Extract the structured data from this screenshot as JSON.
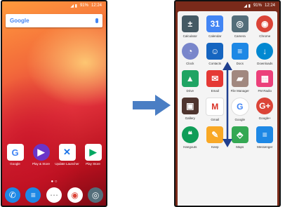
{
  "left_screen": {
    "status": {
      "battery": "91%",
      "time": "12:24"
    },
    "search": {
      "brand": "Google"
    },
    "apps": [
      {
        "label": "Google",
        "glyph": "G",
        "color": "#ffffff",
        "fg": "#4285f4",
        "icon": "google-icon"
      },
      {
        "label": "Play & Store",
        "glyph": "▶",
        "color": "#6a35c8",
        "fg": "#ffffff",
        "icon": "play-music-icon"
      },
      {
        "label": "Update Launcher",
        "glyph": "✕",
        "color": "#ffffff",
        "fg": "#1a73e8",
        "icon": "launcher-icon"
      },
      {
        "label": "Play Store",
        "glyph": "▶",
        "color": "#ffffff",
        "fg": "#00a862",
        "icon": "play-store-icon"
      }
    ],
    "dock": [
      {
        "glyph": "✆",
        "color": "#1e88e5",
        "icon": "phone-icon"
      },
      {
        "glyph": "≡",
        "color": "#1e88e5",
        "icon": "messages-icon"
      },
      {
        "glyph": "⋯",
        "color": "#ffffff",
        "fg": "#888888",
        "icon": "app-drawer-icon"
      },
      {
        "glyph": "◉",
        "color": "#ffffff",
        "fg": "#db4437",
        "icon": "chrome-icon"
      },
      {
        "glyph": "◎",
        "color": "#546e7a",
        "icon": "camera-icon"
      }
    ]
  },
  "right_screen": {
    "status": {
      "battery": "91%",
      "time": "12:24"
    },
    "apps": [
      {
        "label": "Calculator",
        "glyph": "±",
        "color": "#455a64",
        "icon": "calculator-icon"
      },
      {
        "label": "Calendar",
        "glyph": "31",
        "color": "#4285f4",
        "icon": "calendar-icon"
      },
      {
        "label": "Camera",
        "glyph": "◎",
        "color": "#546e7a",
        "icon": "camera-icon"
      },
      {
        "label": "Chrome",
        "glyph": "◉",
        "color": "#db4437",
        "icon": "chrome-icon",
        "round": true
      },
      {
        "label": "Clock",
        "glyph": "◔",
        "color": "#7986cb",
        "icon": "clock-icon",
        "round": true
      },
      {
        "label": "Contacts",
        "glyph": "☺",
        "color": "#1565c0",
        "icon": "contacts-icon"
      },
      {
        "label": "Docs",
        "glyph": "≡",
        "color": "#1e88e5",
        "icon": "docs-icon"
      },
      {
        "label": "Downloads",
        "glyph": "↓",
        "color": "#0288d1",
        "icon": "downloads-icon",
        "round": true
      },
      {
        "label": "Drive",
        "glyph": "▲",
        "color": "#1fa463",
        "icon": "drive-icon"
      },
      {
        "label": "Email",
        "glyph": "✉",
        "color": "#e53935",
        "icon": "email-icon"
      },
      {
        "label": "File Manager",
        "glyph": "▰",
        "color": "#a1887f",
        "icon": "file-manager-icon"
      },
      {
        "label": "FM Radio",
        "glyph": "▦",
        "color": "#ec407a",
        "icon": "radio-icon"
      },
      {
        "label": "Gallery",
        "glyph": "▣",
        "color": "#4e342e",
        "icon": "gallery-icon"
      },
      {
        "label": "Gmail",
        "glyph": "M",
        "color": "#ffffff",
        "fg": "#d93025",
        "icon": "gmail-icon"
      },
      {
        "label": "Google",
        "glyph": "G",
        "color": "#ffffff",
        "fg": "#4285f4",
        "icon": "google-icon",
        "round": true
      },
      {
        "label": "Google+",
        "glyph": "G+",
        "color": "#db4437",
        "icon": "google-plus-icon",
        "round": true
      },
      {
        "label": "Hangouts",
        "glyph": "❝",
        "color": "#0f9d58",
        "icon": "hangouts-icon",
        "round": true
      },
      {
        "label": "Keep",
        "glyph": "✎",
        "color": "#f9a825",
        "icon": "keep-icon"
      },
      {
        "label": "Maps",
        "glyph": "⬘",
        "color": "#34a853",
        "icon": "maps-icon"
      },
      {
        "label": "Messenger",
        "glyph": "≡",
        "color": "#1e88e5",
        "icon": "messenger-icon"
      }
    ]
  }
}
